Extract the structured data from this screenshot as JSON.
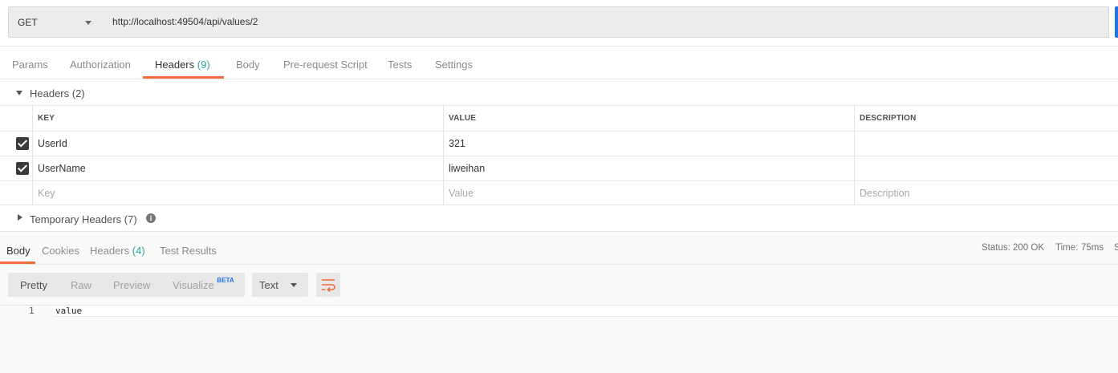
{
  "request": {
    "method": "GET",
    "url": "http://localhost:49504/api/values/2"
  },
  "request_tabs": {
    "params": "Params",
    "authorization": "Authorization",
    "headers": "Headers",
    "headers_count": "(9)",
    "body": "Body",
    "pre_request_script": "Pre-request Script",
    "tests": "Tests",
    "settings": "Settings"
  },
  "headers_section": {
    "title": "Headers (2)",
    "columns": {
      "key": "KEY",
      "value": "VALUE",
      "description": "DESCRIPTION"
    },
    "rows": [
      {
        "checked": true,
        "key": "UserId",
        "value": "321",
        "description": ""
      },
      {
        "checked": true,
        "key": "UserName",
        "value": "liweihan",
        "description": ""
      }
    ],
    "placeholders": {
      "key": "Key",
      "value": "Value",
      "description": "Description"
    }
  },
  "temporary_headers": {
    "title": "Temporary Headers (7)"
  },
  "response_tabs": {
    "body": "Body",
    "cookies": "Cookies",
    "headers": "Headers",
    "headers_count": "(4)",
    "test_results": "Test Results"
  },
  "response_meta": {
    "status_label": "Status:",
    "status_value": "200 OK",
    "time_label": "Time:",
    "time_value": "75ms",
    "size_label_cut": "S"
  },
  "format_controls": {
    "pretty": "Pretty",
    "raw": "Raw",
    "preview": "Preview",
    "visualize": "Visualize",
    "beta": "BETA",
    "type": "Text"
  },
  "response_body": {
    "line_number": "1",
    "content": "value"
  },
  "colors": {
    "accent_orange": "#f26b3a",
    "status_green": "#26a69a",
    "send_blue": "#1a73e8"
  }
}
